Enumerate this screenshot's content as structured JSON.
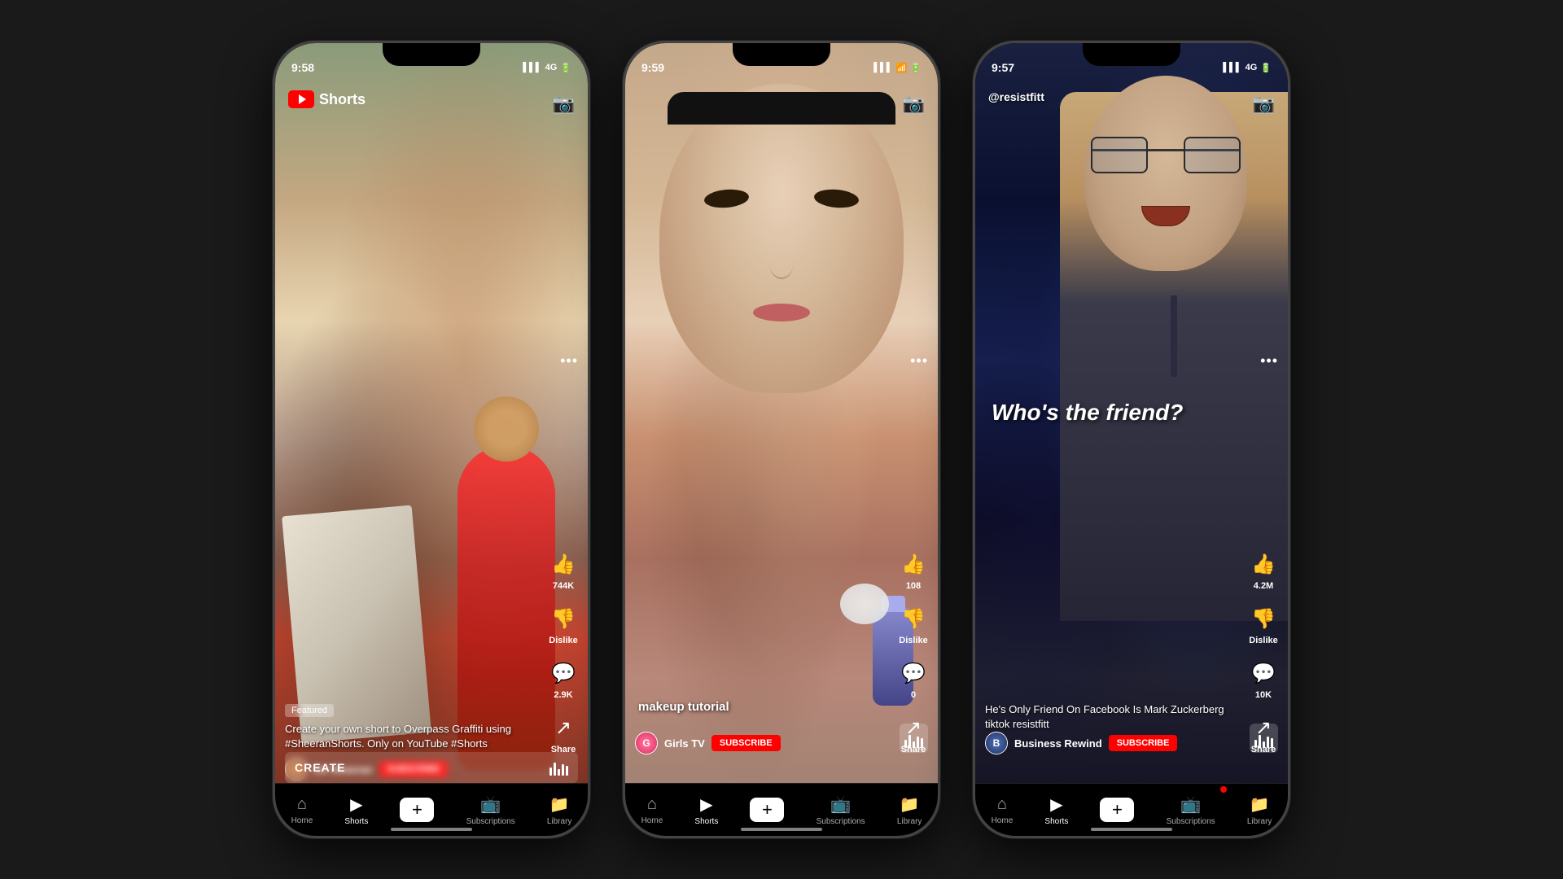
{
  "phones": [
    {
      "id": "phone1",
      "time": "9:58",
      "signal": "4G",
      "battery": "█",
      "yt_shorts_label": "Shorts",
      "featured_badge": "Featured",
      "video_title": "Create your own short to Overpass Graffiti using #SheeranShorts. Only on YouTube #Shorts",
      "channel_name": "Ed Sheeran",
      "subscribe_label": "SUBSCRIBE",
      "like_count": "744K",
      "dislike_label": "Dislike",
      "comments_count": "2.9K",
      "share_label": "Share",
      "create_label": "CREATE",
      "nav": {
        "home": "Home",
        "shorts": "Shorts",
        "add": "+",
        "subscriptions": "Subscriptions",
        "library": "Library"
      }
    },
    {
      "id": "phone2",
      "time": "9:59",
      "signal": "",
      "battery": "█",
      "video_label": "makeup tutorial",
      "channel_name": "Girls TV",
      "subscribe_label": "SUBSCRIBE",
      "like_count": "108",
      "dislike_label": "Dislike",
      "comments_count": "0",
      "share_label": "Share",
      "nav": {
        "home": "Home",
        "shorts": "Shorts",
        "add": "+",
        "subscriptions": "Subscriptions",
        "library": "Library"
      }
    },
    {
      "id": "phone3",
      "time": "9:57",
      "signal": "4G",
      "battery": "█",
      "username": "@resistfitt",
      "video_title_big": "Who's the friend?",
      "video_description": "He's Only Friend On Facebook Is Mark Zuckerberg tiktok resistfitt",
      "channel_name": "Business Rewind",
      "subscribe_label": "SUBSCRIBE",
      "like_count": "4.2M",
      "dislike_label": "Dislike",
      "comments_count": "10K",
      "share_label": "Share",
      "nav": {
        "home": "Home",
        "shorts": "Shorts",
        "add": "+",
        "subscriptions": "Subscriptions",
        "library": "Library"
      }
    }
  ]
}
